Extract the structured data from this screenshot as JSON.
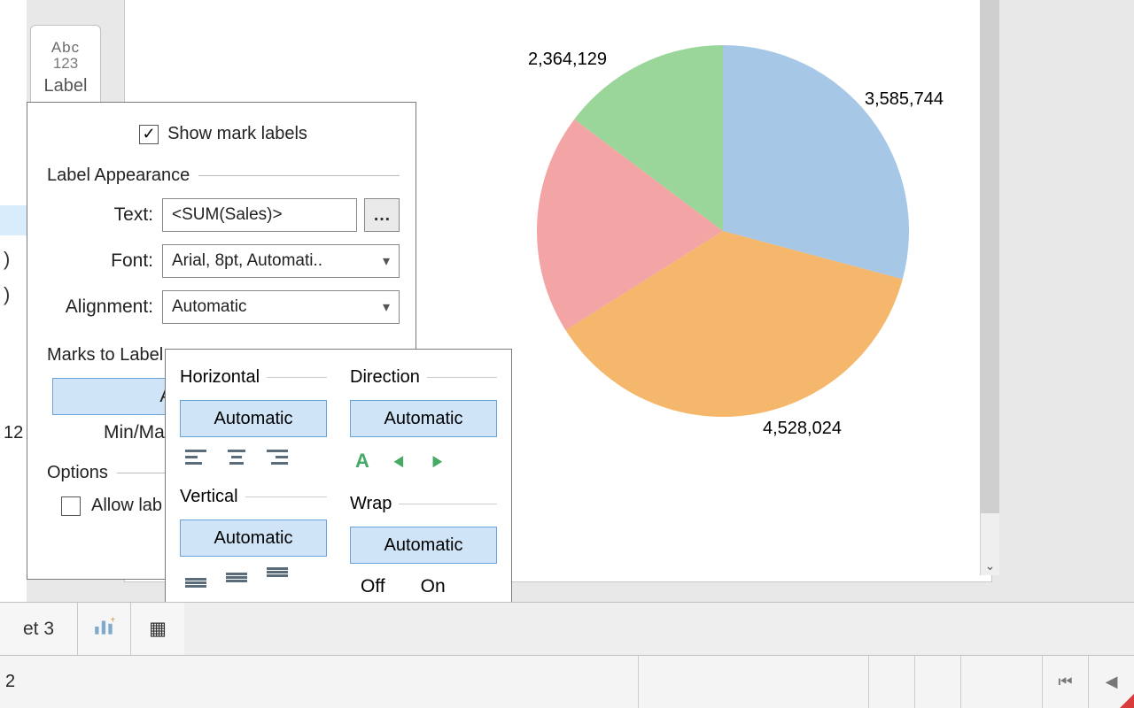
{
  "chart_data": {
    "type": "pie",
    "slices": [
      {
        "label": "3,585,744",
        "value": 3585744,
        "color": "#a7c7e7"
      },
      {
        "label": "4,528,024",
        "value": 4528024,
        "color": "#f5b76b"
      },
      {
        "label": "2,364,129",
        "value": 2364129,
        "color": "#f3a4a4"
      },
      {
        "label": "",
        "value": 1810000,
        "color": "#9ad69a"
      }
    ],
    "title": "",
    "xlabel": "",
    "ylabel": ""
  },
  "marks_card": {
    "abc": "Abc",
    "nums": "123",
    "label": "Label"
  },
  "label_popup": {
    "show_mark_labels_label": "Show mark labels",
    "show_mark_labels_checked": true,
    "section_appearance": "Label Appearance",
    "text_label": "Text:",
    "text_value": "<SUM(Sales)>",
    "font_label": "Font:",
    "font_value": "Arial, 8pt, Automati..",
    "alignment_label": "Alignment:",
    "alignment_value": "Automatic",
    "section_marks": "Marks to Label",
    "all_button": "All",
    "minmax_label": "Min/Max",
    "section_options": "Options",
    "allow_label": "Allow lab"
  },
  "align_popup": {
    "horizontal_label": "Horizontal",
    "horizontal_auto": "Automatic",
    "direction_label": "Direction",
    "direction_auto": "Automatic",
    "vertical_label": "Vertical",
    "vertical_auto": "Automatic",
    "wrap_label": "Wrap",
    "wrap_auto": "Automatic",
    "wrap_off": "Off",
    "wrap_on": "On",
    "dir_a": "A",
    "dir_left": "◄",
    "dir_right": "►"
  },
  "tabs": {
    "sheet_partial": "et 3"
  },
  "left_shelf": {
    "num": "12"
  },
  "status": {
    "left_partial": "2"
  }
}
